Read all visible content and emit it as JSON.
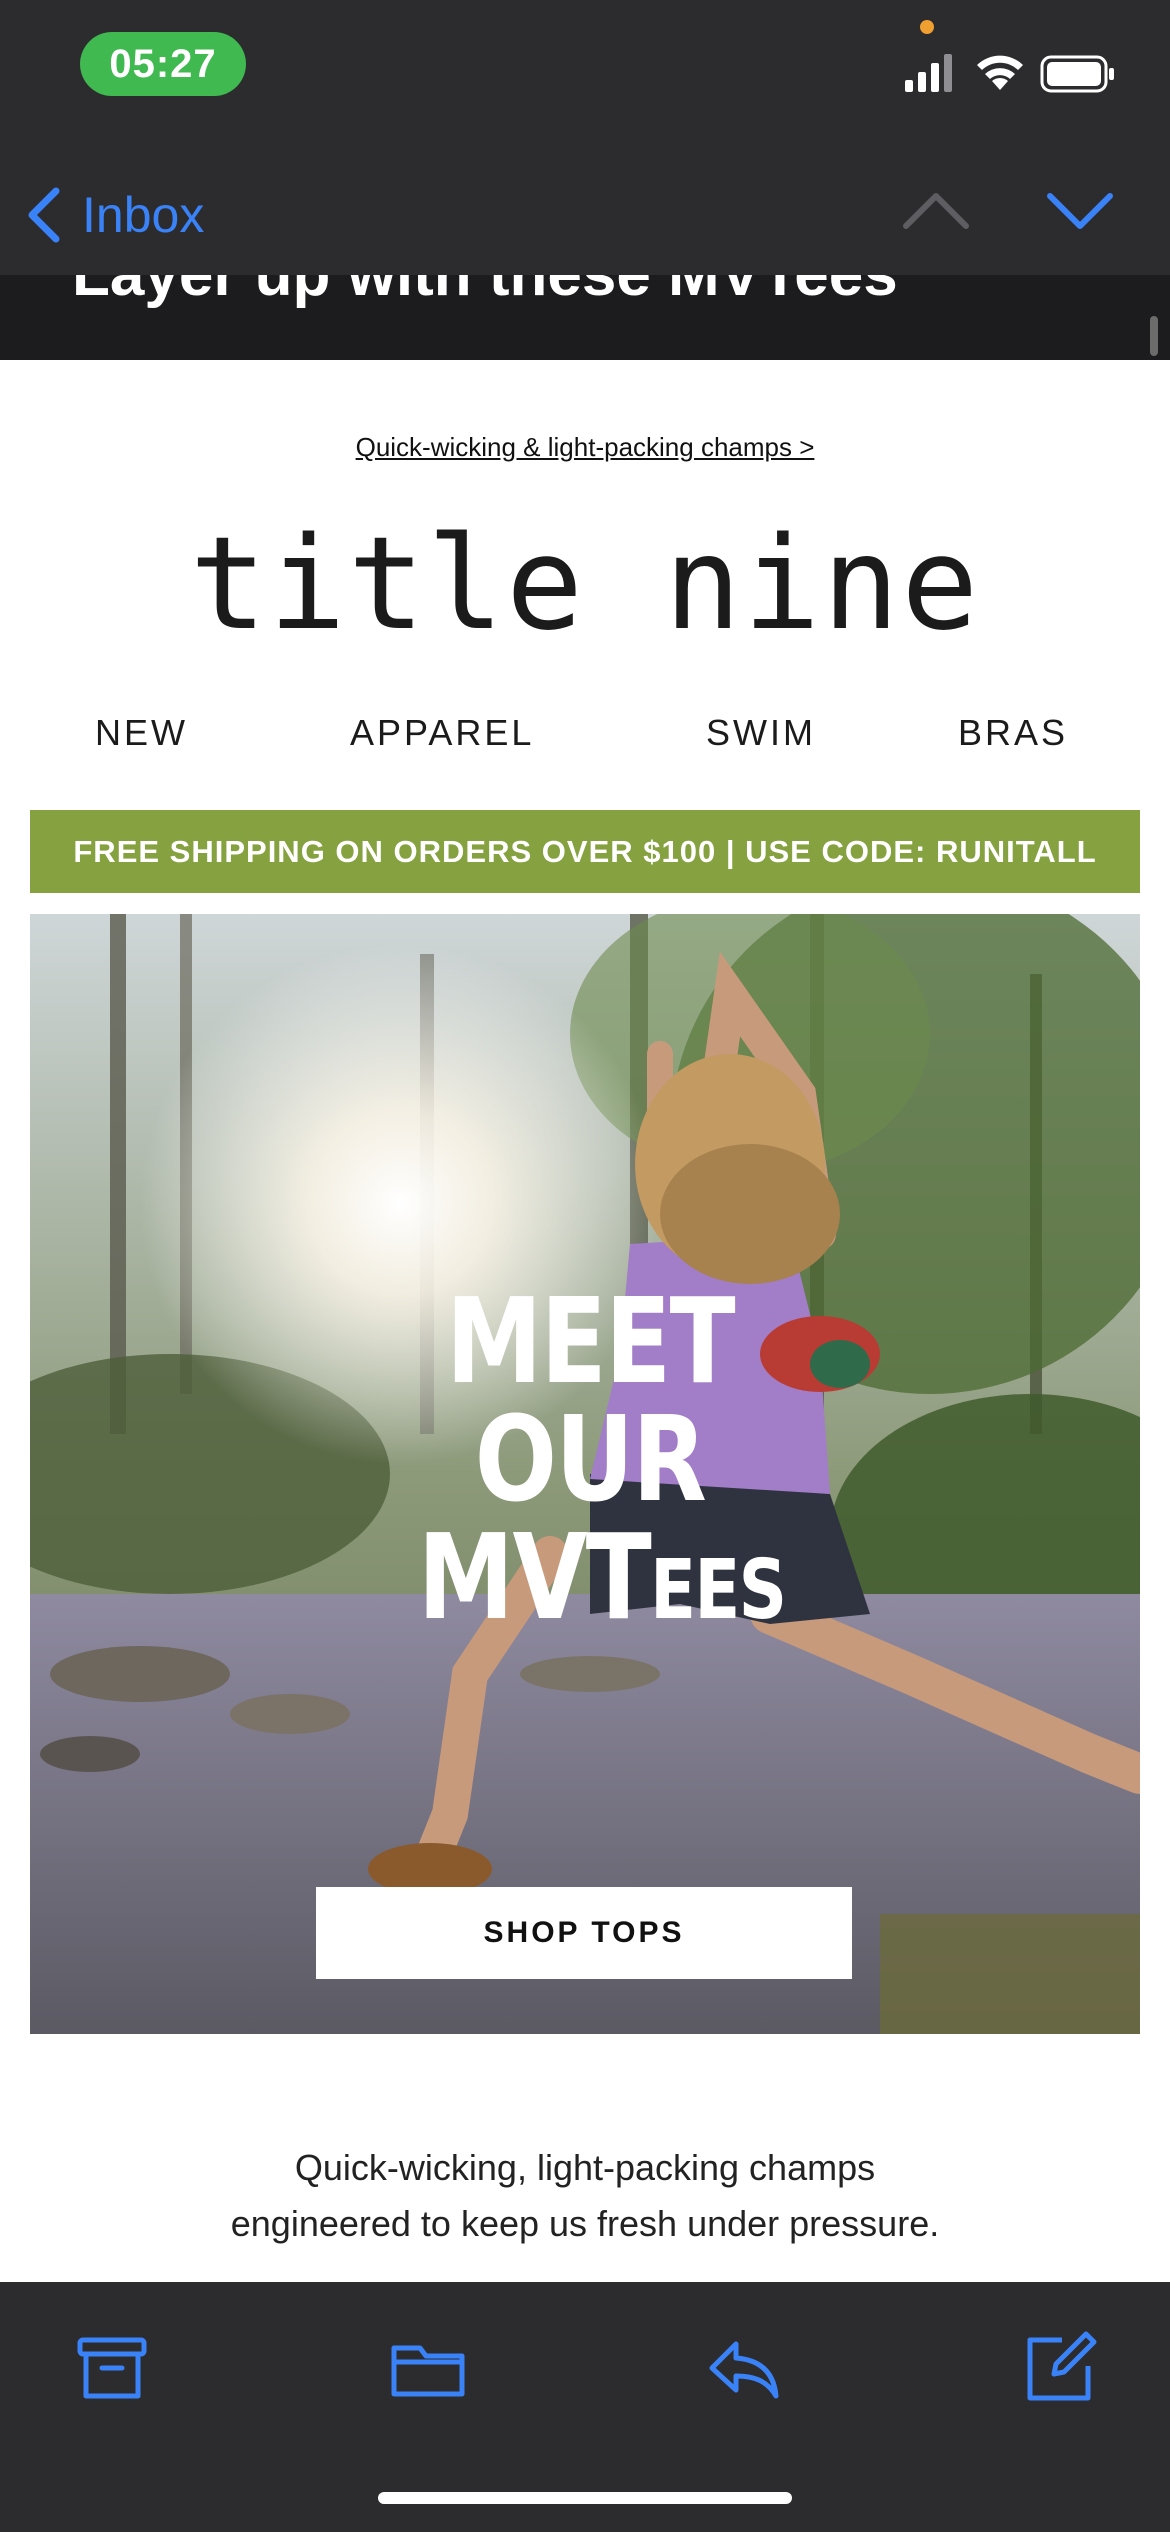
{
  "status_bar": {
    "time": "05:27"
  },
  "nav": {
    "back_label": "Inbox"
  },
  "subject": {
    "text": "Layer up with these MVTees"
  },
  "email": {
    "preheader": "Quick-wicking & light-packing champs >",
    "brand": "title nine",
    "menu": [
      "NEW",
      "APPAREL",
      "SWIM",
      "BRAS"
    ],
    "promo": "FREE SHIPPING ON ORDERS OVER $100 | USE CODE: RUNITALL",
    "hero": {
      "line1": "MEET",
      "line2": "OUR",
      "line3_main": "MVT",
      "line3_small": "EES",
      "cta": "SHOP TOPS"
    },
    "tagline_line1": "Quick-wicking, light-packing champs",
    "tagline_line2": "engineered to keep us fresh under pressure."
  },
  "toolbar": {
    "icons": [
      "archive-icon",
      "folder-icon",
      "reply-icon",
      "compose-icon"
    ]
  },
  "colors": {
    "accent_blue": "#3a82f7",
    "time_pill_green": "#3fb950",
    "promo_green": "#86a13f",
    "bar_dark": "#2c2c2e"
  }
}
